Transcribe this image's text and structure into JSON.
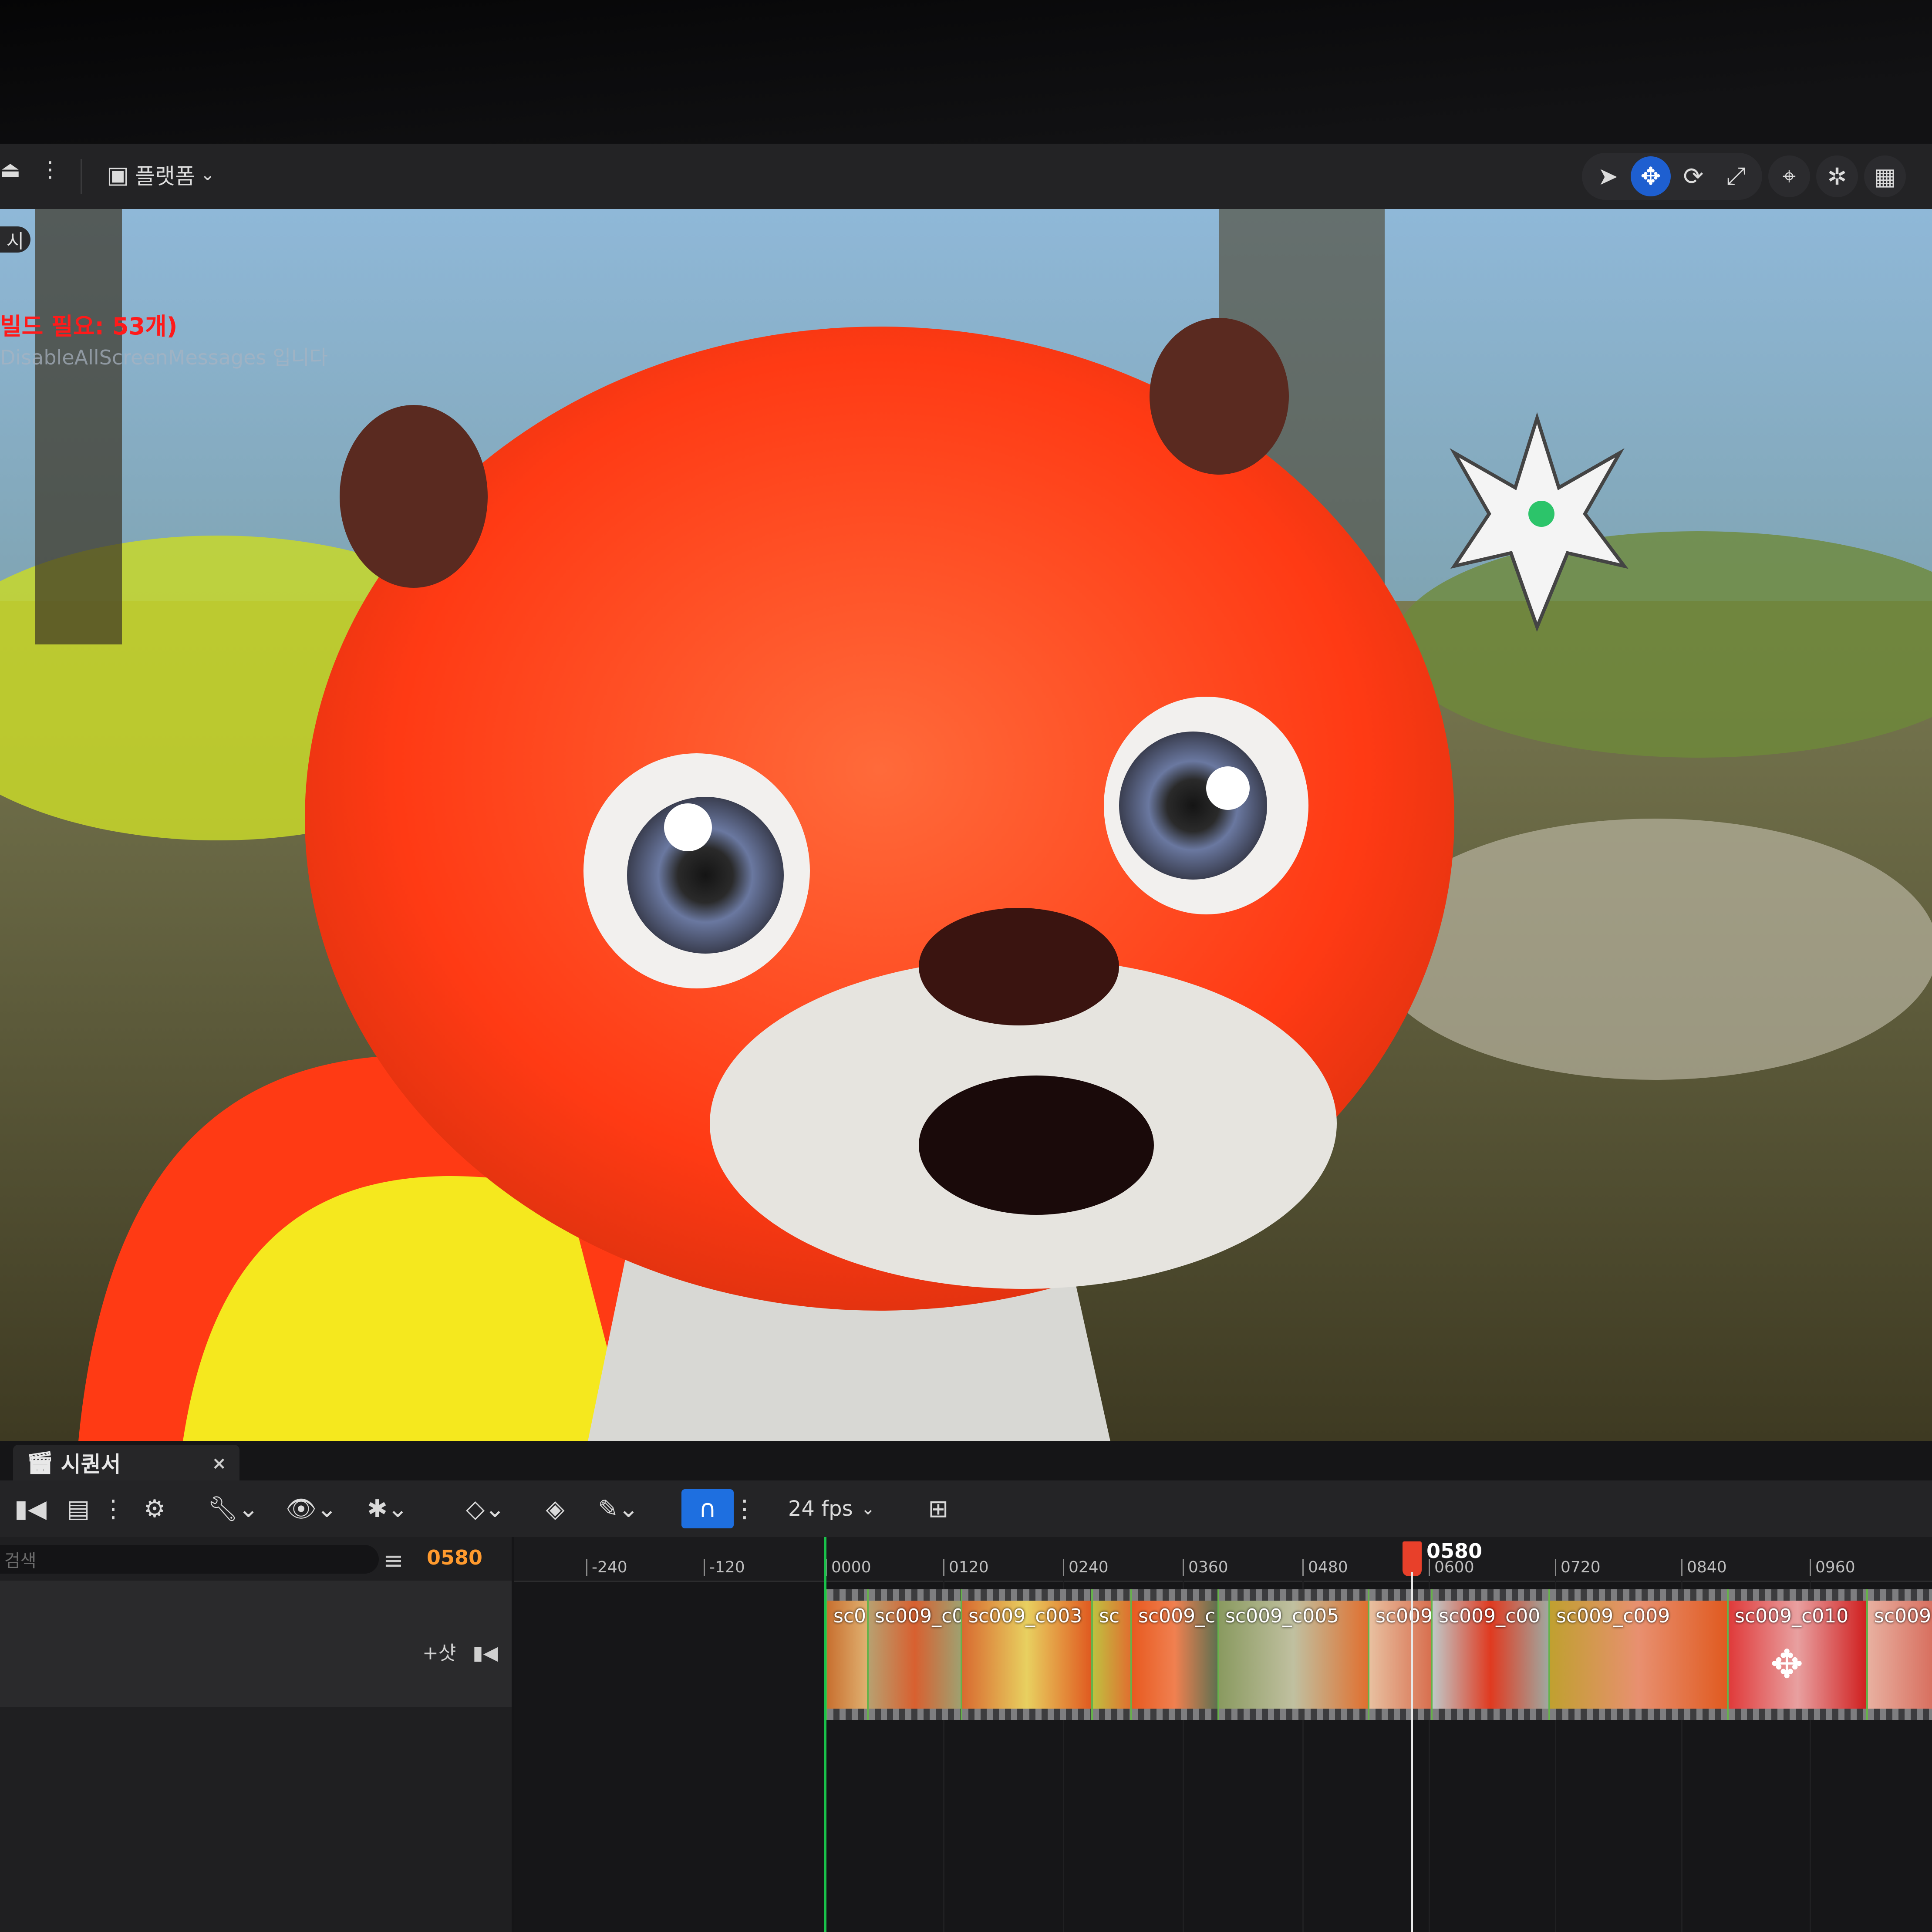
{
  "toolbar": {
    "platform_label": "플랫폼",
    "viewport_tools": [
      "select-tool",
      "move-tool",
      "rotate-tool",
      "scale-tool",
      "surface-snap",
      "camera-speed",
      "grid"
    ]
  },
  "viewport": {
    "side_label": "시",
    "message_red": "빌드 필요: 53개)",
    "message_gray": "DisableAllScreenMessages 입니다"
  },
  "sequencer": {
    "tab_label": "시퀀서",
    "tab_close": "×",
    "search_placeholder": "검색",
    "current_frame": "0580",
    "fps": "24 fps",
    "add_shot_label": "+샷",
    "playhead_label": "0580",
    "ticks": [
      "-240",
      "-120",
      "0000",
      "0120",
      "0240",
      "0360",
      "0480",
      "0600",
      "0720",
      "0840",
      "0960"
    ],
    "shots": [
      {
        "label": "sc0"
      },
      {
        "label": "sc009_c0"
      },
      {
        "label": "sc009_c003"
      },
      {
        "label": "sc"
      },
      {
        "label": "sc009_c"
      },
      {
        "label": "sc009_c005"
      },
      {
        "label": "sc009"
      },
      {
        "label": "sc009_c00"
      },
      {
        "label": "sc009_c009"
      },
      {
        "label": "sc009_c010"
      },
      {
        "label": "sc009"
      }
    ]
  },
  "colors": {
    "accent": "#1e6fe0",
    "playhead": "#e8402a",
    "current_frame": "#ff9a2e",
    "start_marker": "#19c24a"
  }
}
